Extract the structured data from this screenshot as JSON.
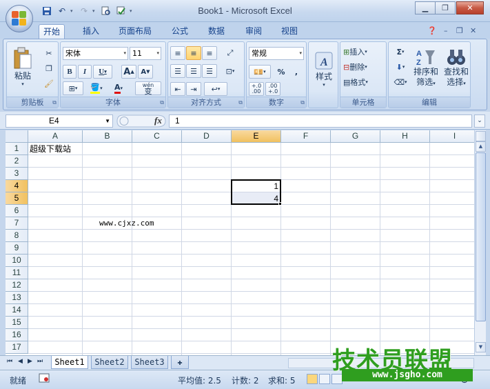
{
  "window": {
    "title": "Book1 - Microsoft Excel"
  },
  "ribbon": {
    "tabs": [
      "开始",
      "插入",
      "页面布局",
      "公式",
      "数据",
      "审阅",
      "视图"
    ],
    "clipboard": {
      "label": "剪贴板",
      "paste": "粘贴"
    },
    "font": {
      "label": "字体",
      "name": "宋体",
      "size": "11",
      "bold": "B",
      "italic": "I",
      "underline": "U",
      "grow": "A",
      "shrink": "A",
      "color_glyph": "A",
      "wen": "wén",
      "wen_char": "变"
    },
    "alignment": {
      "label": "对齐方式"
    },
    "number": {
      "label": "数字",
      "format": "常规",
      "percent": "%",
      "comma": ",",
      "inc": "+.0",
      "inc2": ".00",
      "dec": ".00",
      "dec2": "+.0"
    },
    "styles": {
      "label": "样式"
    },
    "cells": {
      "label": "单元格",
      "insert": "插入",
      "delete": "删除",
      "format": "格式"
    },
    "editing": {
      "label": "编辑",
      "sigma": "Σ",
      "sort": "排序和",
      "sort2": "筛选",
      "find": "查找和",
      "find2": "选择"
    }
  },
  "formula_bar": {
    "name_box": "E4",
    "fx": "fx",
    "content": "1"
  },
  "grid": {
    "columns": [
      "A",
      "B",
      "C",
      "D",
      "E",
      "F",
      "G",
      "H",
      "I"
    ],
    "rows": [
      "1",
      "2",
      "3",
      "4",
      "5",
      "6",
      "7",
      "8",
      "9",
      "10",
      "11",
      "12",
      "13",
      "14",
      "15",
      "16",
      "17"
    ],
    "active_column": "E",
    "active_rows": [
      "4",
      "5"
    ],
    "cells": {
      "A1": "超级下载站",
      "E4": "1",
      "E5": "4",
      "B7": "www.cjxz.com"
    }
  },
  "sheets": {
    "tabs": [
      "Sheet1",
      "Sheet2",
      "Sheet3"
    ],
    "active": "Sheet1"
  },
  "status_bar": {
    "ready": "就绪",
    "average": "平均值: 2.5",
    "count": "计数: 2",
    "sum": "求和: 5"
  },
  "watermark": {
    "title": "技术员联盟",
    "url": "www.jsgho.com"
  },
  "colors": {
    "accent_orange": "#f1c15f",
    "ribbon_blue": "#15428b",
    "watermark_green": "#2f9e1f"
  }
}
